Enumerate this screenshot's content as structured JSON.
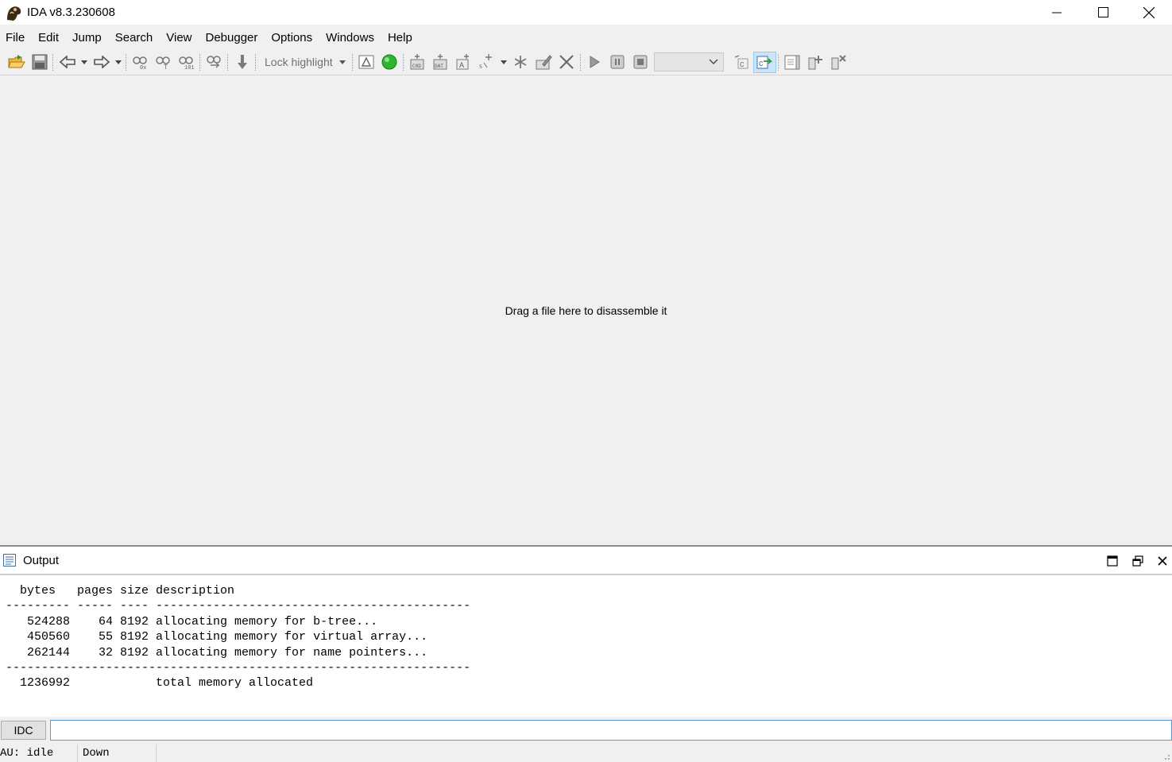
{
  "window": {
    "title": "IDA v8.3.230608"
  },
  "menu": {
    "items": [
      {
        "label": "File"
      },
      {
        "label": "Edit"
      },
      {
        "label": "Jump"
      },
      {
        "label": "Search"
      },
      {
        "label": "View"
      },
      {
        "label": "Debugger"
      },
      {
        "label": "Options"
      },
      {
        "label": "Windows"
      },
      {
        "label": "Help"
      }
    ]
  },
  "toolbar": {
    "lock_highlight_label": "Lock highlight",
    "debugger_combo_value": ""
  },
  "main": {
    "drag_hint": "Drag a file here to disassemble it"
  },
  "output": {
    "title": "Output",
    "lines": [
      "  bytes   pages size description",
      "--------- ----- ---- --------------------------------------------",
      "   524288    64 8192 allocating memory for b-tree...",
      "   450560    55 8192 allocating memory for virtual array...",
      "   262144    32 8192 allocating memory for name pointers...",
      "-----------------------------------------------------------------",
      "  1236992            total memory allocated"
    ]
  },
  "command": {
    "language_label": "IDC",
    "value": ""
  },
  "status": {
    "au_label": "AU:",
    "au_state": "idle",
    "direction": "Down"
  },
  "colors": {
    "accent_blue": "#5b9bd5",
    "green_go": "#2fb52f",
    "folder_yellow": "#f2b630"
  }
}
